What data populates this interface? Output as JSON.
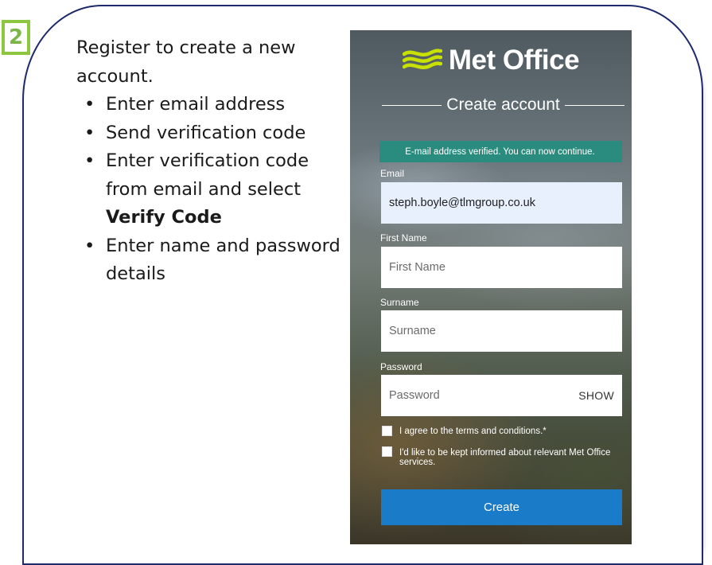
{
  "step_number": "2",
  "instructions": {
    "intro": "Register to create a new account.",
    "steps": [
      {
        "text": "Enter email address"
      },
      {
        "text": "Send verification code"
      },
      {
        "text": "Enter verification code from email and select ",
        "bold": "Verify Code"
      },
      {
        "text": "Enter name and password details"
      }
    ],
    "bullet_glyph": "•"
  },
  "app": {
    "logo_text": "Met Office",
    "logo_icon": "met-office-waves-icon",
    "heading": "Create account",
    "verified_message": "E-mail address verified. You can now continue.",
    "email": {
      "label": "Email",
      "value": "steph.boyle@tlmgroup.co.uk"
    },
    "first_name": {
      "label": "First Name",
      "placeholder": "First Name"
    },
    "surname": {
      "label": "Surname",
      "placeholder": "Surname"
    },
    "password": {
      "label": "Password",
      "placeholder": "Password",
      "show_label": "SHOW"
    },
    "terms_checkbox": "I agree to the terms and conditions.*",
    "info_checkbox": "I'd like to be kept informed about relevant Met Office services.",
    "create_button": "Create"
  },
  "colors": {
    "badge_green": "#8dc63f",
    "frame_navy": "#1d2a6b",
    "verified_teal": "#2a8c7e",
    "button_blue": "#1a7bc8",
    "autofill_blue": "#e8f0fe"
  }
}
